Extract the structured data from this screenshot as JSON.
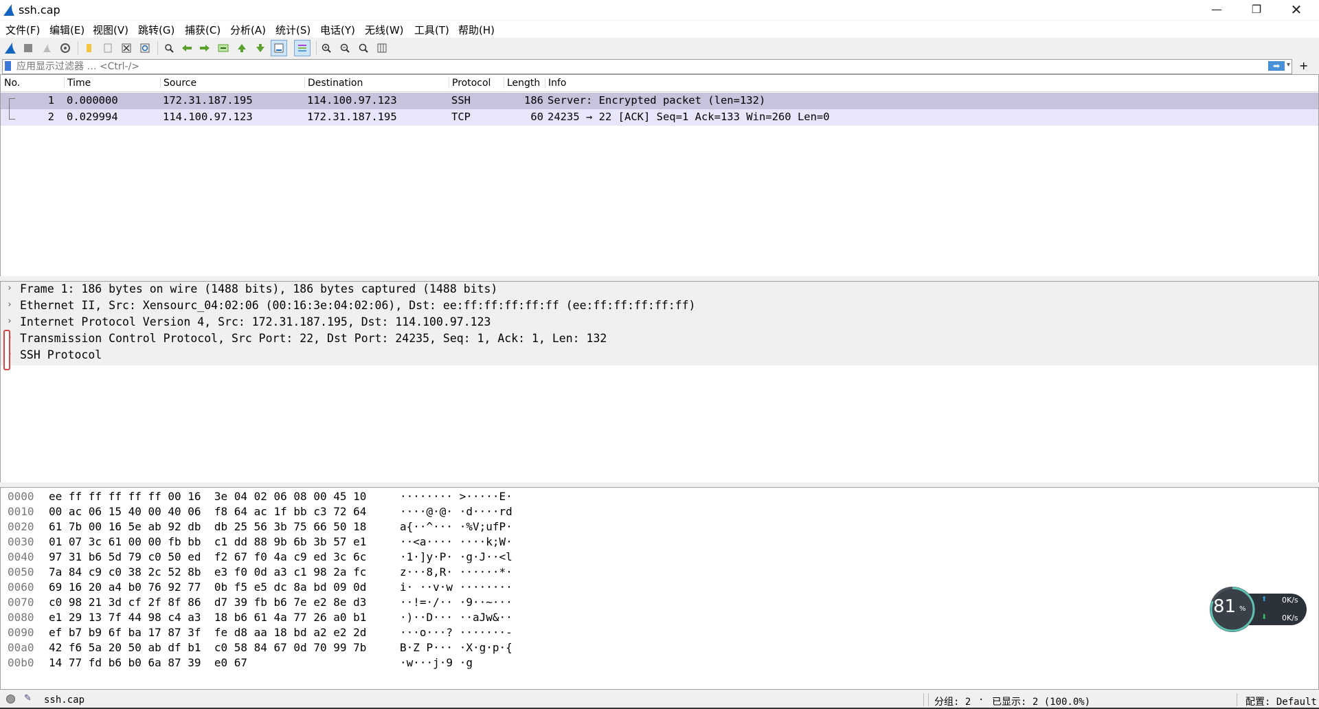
{
  "window": {
    "title": "ssh.cap",
    "min": "—",
    "max": "❐",
    "close": "✕"
  },
  "menu": [
    "文件(F)",
    "编辑(E)",
    "视图(V)",
    "跳转(G)",
    "捕获(C)",
    "分析(A)",
    "统计(S)",
    "电话(Y)",
    "无线(W)",
    "工具(T)",
    "帮助(H)"
  ],
  "filter": {
    "placeholder": "应用显示过滤器 … <Ctrl-/>",
    "apply": "➡",
    "dropdown": "▾",
    "add": "+"
  },
  "packet_list": {
    "columns": [
      "No.",
      "Time",
      "Source",
      "Destination",
      "Protocol",
      "Length",
      "Info"
    ],
    "rows": [
      {
        "no": "1",
        "time": "0.000000",
        "source": "172.31.187.195",
        "destination": "114.100.97.123",
        "protocol": "SSH",
        "length": "186",
        "info": "Server: Encrypted packet (len=132)"
      },
      {
        "no": "2",
        "time": "0.029994",
        "source": "114.100.97.123",
        "destination": "172.31.187.195",
        "protocol": "TCP",
        "length": "60",
        "info": "24235 → 22 [ACK] Seq=1 Ack=133 Win=260 Len=0"
      }
    ],
    "selected_row_color": "#c7c3dd",
    "row_color": "#e8e6fb"
  },
  "details": {
    "arrow": "›",
    "rows": [
      "Frame 1: 186 bytes on wire (1488 bits), 186 bytes captured (1488 bits)",
      "Ethernet II, Src: Xensourc_04:02:06 (00:16:3e:04:02:06), Dst: ee:ff:ff:ff:ff:ff (ee:ff:ff:ff:ff:ff)",
      "Internet Protocol Version 4, Src: 172.31.187.195, Dst: 114.100.97.123",
      "Transmission Control Protocol, Src Port: 22, Dst Port: 24235, Seq: 1, Ack: 1, Len: 132",
      "SSH Protocol"
    ]
  },
  "hex": [
    {
      "offset": "0000",
      "bytes": "ee ff ff ff ff ff 00 16  3e 04 02 06 08 00 45 10",
      "ascii": "········ >·····E·"
    },
    {
      "offset": "0010",
      "bytes": "00 ac 06 15 40 00 40 06  f8 64 ac 1f bb c3 72 64",
      "ascii": "····@·@· ·d····rd"
    },
    {
      "offset": "0020",
      "bytes": "61 7b 00 16 5e ab 92 db  db 25 56 3b 75 66 50 18",
      "ascii": "a{··^··· ·%V;ufP·"
    },
    {
      "offset": "0030",
      "bytes": "01 07 3c 61 00 00 fb bb  c1 dd 88 9b 6b 3b 57 e1",
      "ascii": "··<a···· ····k;W·"
    },
    {
      "offset": "0040",
      "bytes": "97 31 b6 5d 79 c0 50 ed  f2 67 f0 4a c9 ed 3c 6c",
      "ascii": "·1·]y·P· ·g·J··<l"
    },
    {
      "offset": "0050",
      "bytes": "7a 84 c9 c0 38 2c 52 8b  e3 f0 0d a3 c1 98 2a fc",
      "ascii": "z···8,R· ······*·"
    },
    {
      "offset": "0060",
      "bytes": "69 16 20 a4 b0 76 92 77  0b f5 e5 dc 8a bd 09 0d",
      "ascii": "i· ··v·w ········"
    },
    {
      "offset": "0070",
      "bytes": "c0 98 21 3d cf 2f 8f 86  d7 39 fb b6 7e e2 8e d3",
      "ascii": "··!=·/·· ·9··~···"
    },
    {
      "offset": "0080",
      "bytes": "e1 29 13 7f 44 98 c4 a3  18 b6 61 4a 77 26 a0 b1",
      "ascii": "·)··D··· ··aJw&··"
    },
    {
      "offset": "0090",
      "bytes": "ef b7 b9 6f ba 17 87 3f  fe d8 aa 18 bd a2 e2 2d",
      "ascii": "···o···? ·······-"
    },
    {
      "offset": "00a0",
      "bytes": "42 f6 5a 20 50 ab df b1  c0 58 84 67 0d 70 99 7b",
      "ascii": "B·Z P··· ·X·g·p·{"
    },
    {
      "offset": "00b0",
      "bytes": "14 77 fd b6 b0 6a 87 39  e0 67",
      "ascii": "·w···j·9 ·g"
    }
  ],
  "net_widget": {
    "percent": "81",
    "percent_sign": "%",
    "up_arrow": "⬆",
    "down_arrow": "⬇",
    "up": "0K/s",
    "down": "0K/s",
    "cpu_level": 0.81
  },
  "status": {
    "file": "ssh.cap",
    "edit_icon": "✎",
    "packets": "分组: 2",
    "dot": "·",
    "displayed": "已显示: 2 (100.0%)",
    "profile": "配置: Default"
  }
}
